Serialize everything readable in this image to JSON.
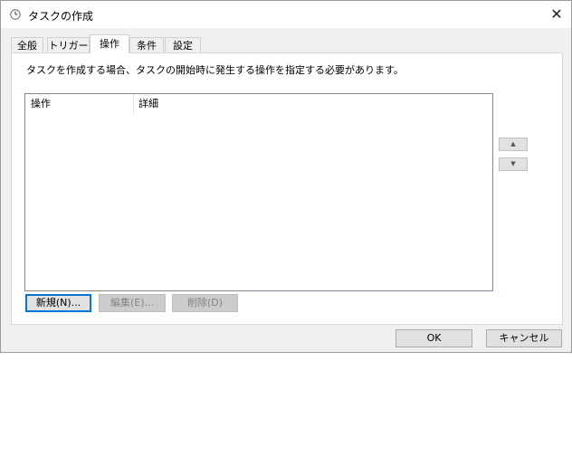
{
  "window": {
    "title": "タスクの作成",
    "close_glyph": "✕"
  },
  "tabs": [
    {
      "label": "全般",
      "active": false
    },
    {
      "label": "トリガー",
      "active": false
    },
    {
      "label": "操作",
      "active": true
    },
    {
      "label": "条件",
      "active": false
    },
    {
      "label": "設定",
      "active": false
    }
  ],
  "actions_panel": {
    "instruction": "タスクを作成する場合、タスクの開始時に発生する操作を指定する必要があります。",
    "columns": [
      "操作",
      "詳細"
    ],
    "rows": [],
    "move_up_glyph": "▲",
    "move_down_glyph": "▼",
    "buttons": {
      "new_label": "新規(N)...",
      "edit_label": "編集(E)...",
      "delete_label": "削除(D)"
    }
  },
  "footer": {
    "ok_label": "OK",
    "cancel_label": "キャンセル"
  },
  "colors": {
    "accent": "#0078d7",
    "dialog_bg": "#f0f0f0"
  },
  "icons": {
    "title": "clock-icon",
    "close": "close-icon",
    "up": "up-arrow-icon",
    "down": "down-arrow-icon"
  }
}
